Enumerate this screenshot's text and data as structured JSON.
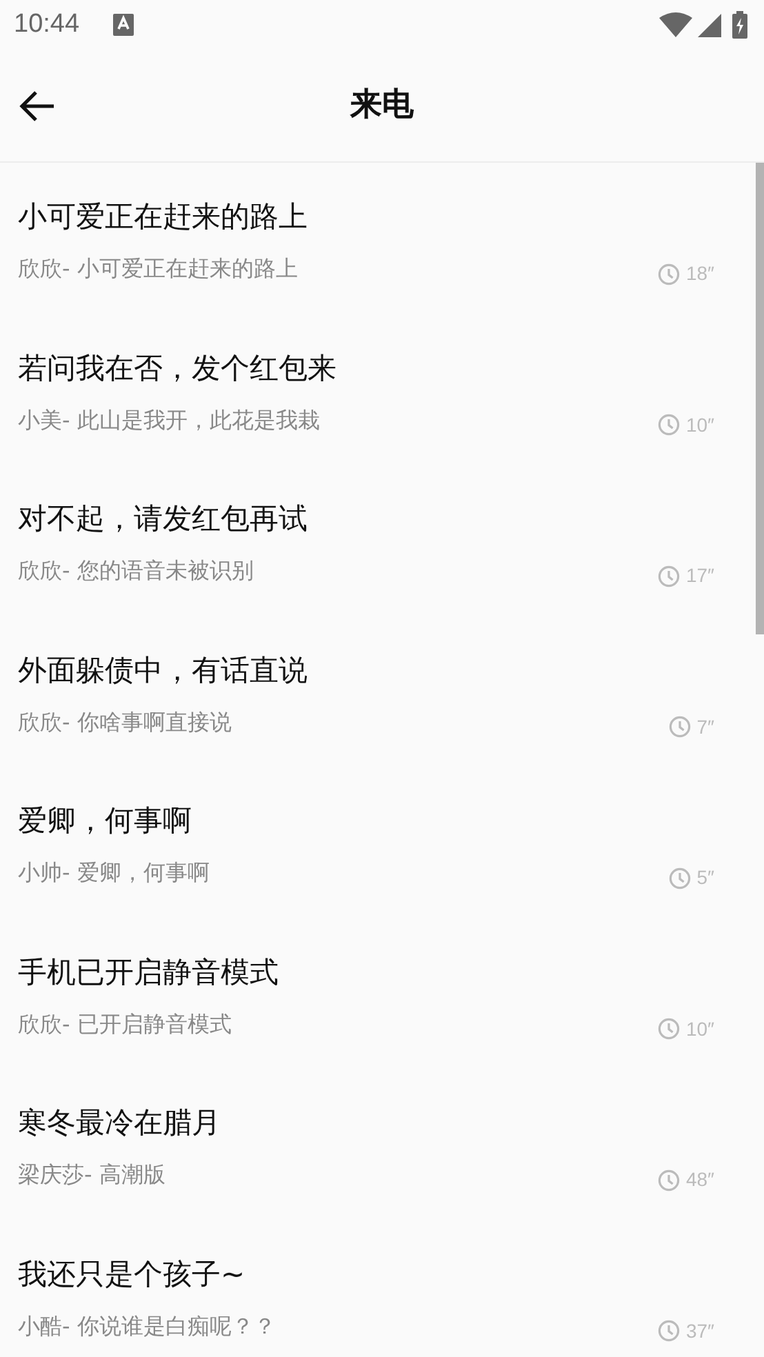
{
  "status_bar": {
    "time": "10:44"
  },
  "header": {
    "title": "来电"
  },
  "items": [
    {
      "title": "小可爱正在赶来的路上",
      "author": "欣欣-",
      "subtitle": "小可爱正在赶来的路上",
      "duration": "18″"
    },
    {
      "title": "若问我在否，发个红包来",
      "author": "小美-",
      "subtitle": "此山是我开，此花是我栽",
      "duration": "10″"
    },
    {
      "title": "对不起，请发红包再试",
      "author": "欣欣-",
      "subtitle": "您的语音未被识别",
      "duration": "17″"
    },
    {
      "title": "外面躲债中，有话直说",
      "author": "欣欣-",
      "subtitle": "你啥事啊直接说",
      "duration": "7″"
    },
    {
      "title": "爱卿，何事啊",
      "author": "小帅-",
      "subtitle": "爱卿，何事啊",
      "duration": "5″"
    },
    {
      "title": "手机已开启静音模式",
      "author": "欣欣-",
      "subtitle": "已开启静音模式",
      "duration": "10″"
    },
    {
      "title": "寒冬最冷在腊月",
      "author": "梁庆莎-",
      "subtitle": "高潮版",
      "duration": "48″"
    },
    {
      "title": "我还只是个孩子~",
      "author": "小酷-",
      "subtitle": "你说谁是白痴呢？？",
      "duration": "37″"
    }
  ]
}
